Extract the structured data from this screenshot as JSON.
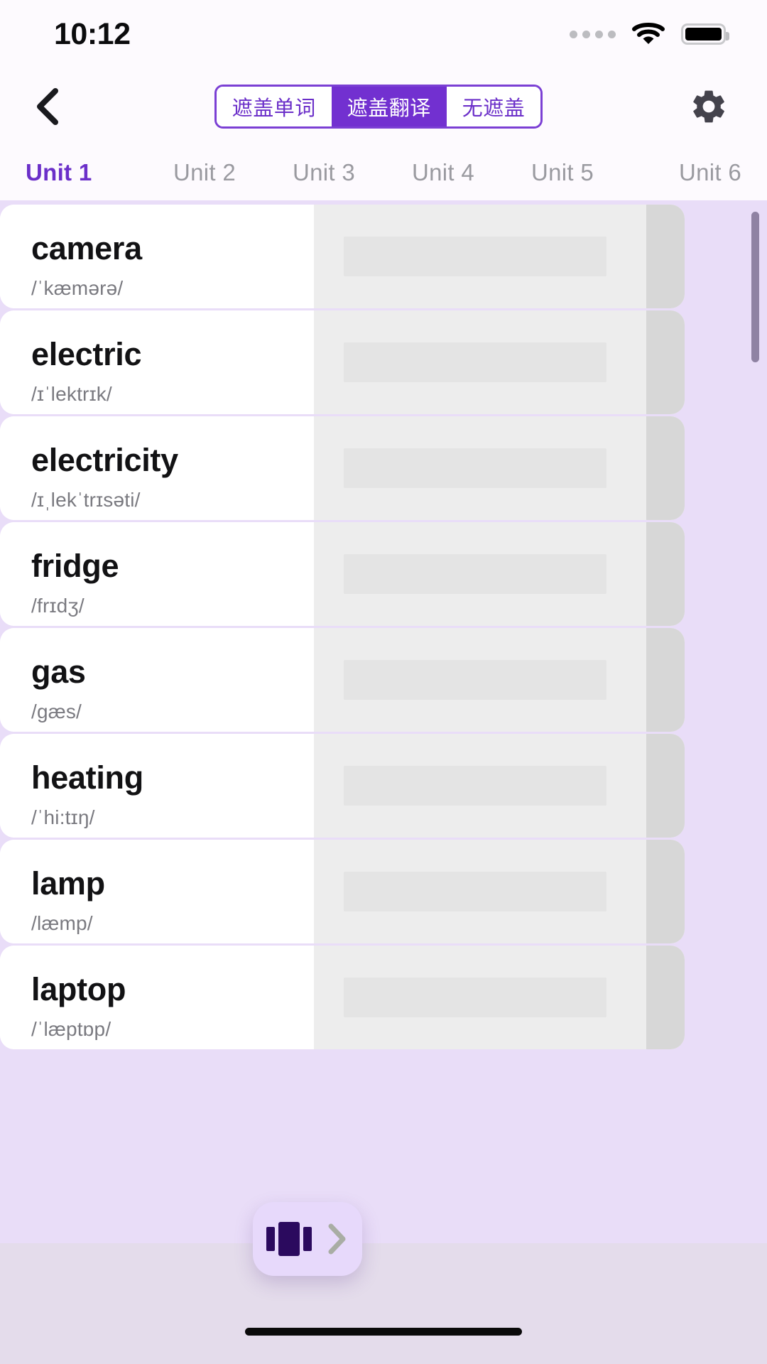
{
  "status_bar": {
    "time": "10:12",
    "signal_icon": "signal-dots-icon",
    "wifi_icon": "wifi-icon",
    "battery_icon": "battery-full-icon"
  },
  "header": {
    "back_icon": "chevron-left-icon",
    "settings_icon": "gear-icon",
    "mask_modes": [
      {
        "label": "遮盖单词",
        "active": false
      },
      {
        "label": "遮盖翻译",
        "active": true
      },
      {
        "label": "无遮盖",
        "active": false
      }
    ]
  },
  "units": [
    {
      "label": "Unit 1",
      "active": true
    },
    {
      "label": "Unit 2",
      "active": false
    },
    {
      "label": "Unit 3",
      "active": false
    },
    {
      "label": "Unit 4",
      "active": false
    },
    {
      "label": "Unit 5",
      "active": false
    },
    {
      "label": "Unit 6",
      "active": false
    }
  ],
  "word_list": [
    {
      "word": "camera",
      "phonetic": "/ˈkæmərə/",
      "translation_masked": true
    },
    {
      "word": "electric",
      "phonetic": "/ɪˈlektrɪk/",
      "translation_masked": true
    },
    {
      "word": "electricity",
      "phonetic": "/ɪˌlekˈtrɪsəti/",
      "translation_masked": true
    },
    {
      "word": "fridge",
      "phonetic": "/frɪdʒ/",
      "translation_masked": true
    },
    {
      "word": "gas",
      "phonetic": "/gæs/",
      "translation_masked": true
    },
    {
      "word": "heating",
      "phonetic": "/ˈhi:tɪŋ/",
      "translation_masked": true
    },
    {
      "word": "lamp",
      "phonetic": "/læmp/",
      "translation_masked": true
    },
    {
      "word": "laptop",
      "phonetic": "/ˈlæptɒp/",
      "translation_masked": true
    }
  ],
  "floating_button": {
    "cards_icon": "flashcard-icon",
    "next_icon": "chevron-right-icon"
  },
  "colors": {
    "accent_purple": "#7230D0",
    "accent_purple_text": "#6B2FC9",
    "list_background": "#E9DDF8",
    "page_background": "#E4DCEB",
    "header_background": "#FDFAFE",
    "card_background": "#FFFFFF",
    "mask_fill": "#EDEDED",
    "mask_edge": "#D7D7D7",
    "fab_background": "#E7D9FB",
    "fab_icon": "#2B0A5E",
    "scrollbar": "#8F82A3"
  }
}
